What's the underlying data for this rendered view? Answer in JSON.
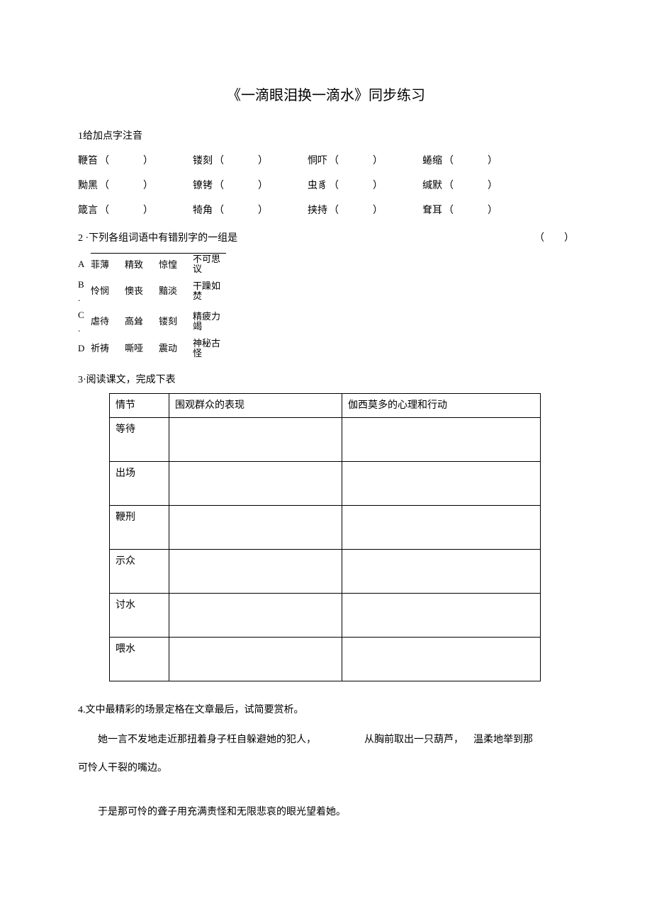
{
  "title": "《一滴眼泪换一滴水》同步练习",
  "q1": {
    "header": "1给加点字注音",
    "rows": [
      [
        "鞭笞",
        "镂刻",
        "恫吓",
        "蜷缩"
      ],
      [
        "黝黑",
        "镣铐",
        "虫豸",
        "缄默"
      ],
      [
        "箴言",
        "犄角",
        "挟持",
        "耷耳"
      ]
    ]
  },
  "q2": {
    "header": "2 ·下列各组词语中有错别字的一组是",
    "options": [
      {
        "letter": "A",
        "w1": "菲薄",
        "w2": "精致",
        "w3": "惊惶",
        "w4a": "不可思",
        "w4b": "议"
      },
      {
        "letter": "B",
        "w1": "怜悯",
        "w2": "懊丧",
        "w3": "黯淡",
        "w4a": "干躁如",
        "w4b": "焚",
        "dot": "."
      },
      {
        "letter": "C",
        "w1": "虐待",
        "w2": "高耸",
        "w3": "镂刻",
        "w4a": "精疲力",
        "w4b": "竭",
        "dot": "."
      },
      {
        "letter": "D",
        "w1": "祈祷",
        "w2": "嘶哑",
        "w3": "震动",
        "w4a": "神秘古",
        "w4b": "怪"
      }
    ]
  },
  "q3": {
    "header": "3·阅读课文，完成下表",
    "cols": [
      "情节",
      "围观群众的表现",
      "伽西莫多的心理和行动"
    ],
    "rows": [
      "等待",
      "出场",
      "鞭刑",
      "示众",
      "讨水",
      "喂水"
    ]
  },
  "q4": {
    "header": "4.文中最精彩的场景定格在文章最后，试简要赏析。",
    "p1a": "她一言不发地走近那扭着身子枉自躲避她的犯人，",
    "p1b": "从胸前取出一只葫芦，",
    "p1c": "温柔地举到那",
    "p2": "可怜人干裂的嘴边。",
    "p3": "于是那可怜的聋子用充满责怪和无限悲哀的眼光望着她。"
  }
}
